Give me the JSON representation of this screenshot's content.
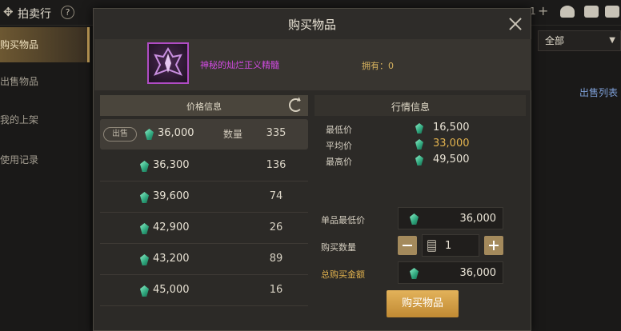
{
  "app": {
    "title": "拍卖行",
    "back_icon": "back-arrow-icon",
    "help_icon": "help-icon",
    "currency_count": "1",
    "sidebar": [
      "购买物品",
      "出售物品",
      "我的上架",
      "使用记录"
    ],
    "filter_selected": "全部",
    "sell_list_link": "出售列表",
    "colors": {
      "accent": "#c9a45a",
      "link": "#7ea0d8"
    }
  },
  "dialog": {
    "title": "购买物品",
    "item": {
      "name": "神秘的灿烂正义精髓",
      "owned_label": "拥有：0",
      "rarity_color": "#d04be0"
    },
    "price_list": {
      "header": "价格信息",
      "sell_tag": "出售",
      "qty_label": "数量",
      "rows": [
        {
          "price": "36,000",
          "qty": "335"
        },
        {
          "price": "36,300",
          "qty": "136"
        },
        {
          "price": "39,600",
          "qty": "74"
        },
        {
          "price": "42,900",
          "qty": "26"
        },
        {
          "price": "43,200",
          "qty": "89"
        },
        {
          "price": "45,000",
          "qty": "16"
        }
      ]
    },
    "market": {
      "header": "行情信息",
      "min_label": "最低价",
      "min_value": "16,500",
      "avg_label": "平均价",
      "avg_value": "33,000",
      "max_label": "最高价",
      "max_value": "49,500"
    },
    "form": {
      "unit_min_label": "单品最低价",
      "unit_min_value": "36,000",
      "qty_label": "购买数量",
      "qty_value": "1",
      "total_label": "总购买金额",
      "total_value": "36,000"
    },
    "buy_button": "购买物品"
  }
}
